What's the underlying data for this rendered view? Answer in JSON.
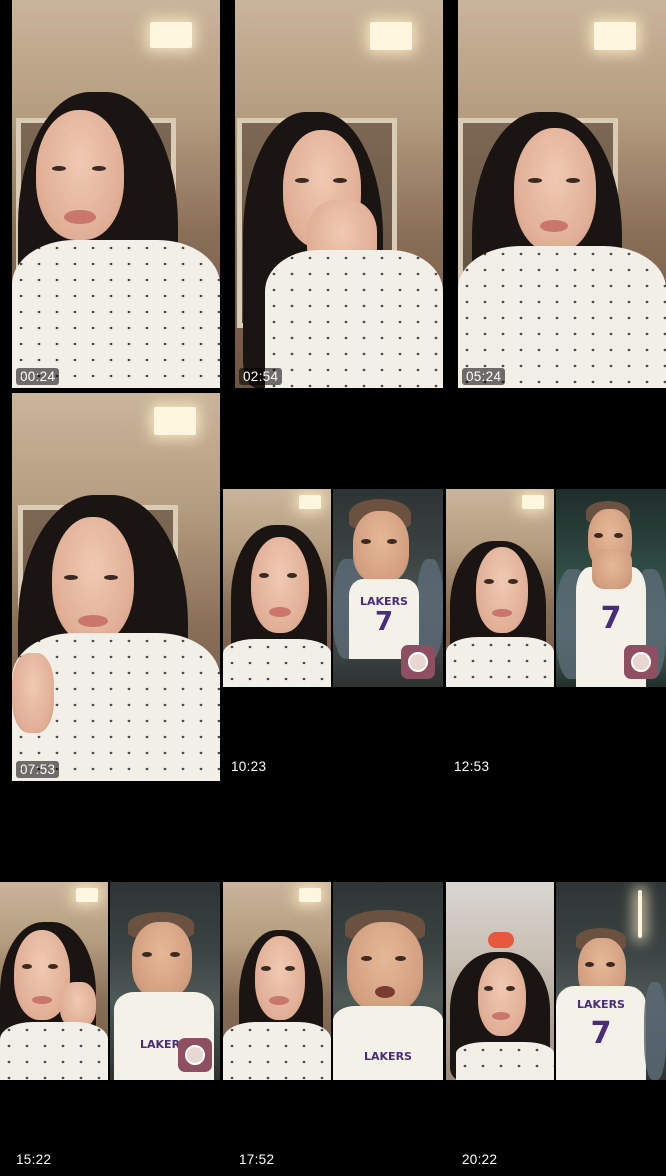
{
  "grid": {
    "tiles": [
      {
        "timestamp": "00:24",
        "layout": "single"
      },
      {
        "timestamp": "02:54",
        "layout": "single"
      },
      {
        "timestamp": "05:24",
        "layout": "single"
      },
      {
        "timestamp": "07:53",
        "layout": "single"
      },
      {
        "timestamp": "10:23",
        "layout": "split"
      },
      {
        "timestamp": "12:53",
        "layout": "split"
      },
      {
        "timestamp": "15:22",
        "layout": "split"
      },
      {
        "timestamp": "17:52",
        "layout": "split"
      },
      {
        "timestamp": "20:22",
        "layout": "split"
      }
    ]
  },
  "jersey": {
    "team": "LAKERS",
    "number": "7"
  },
  "icons": {
    "guest_avatar": "user-avatar-icon",
    "gift_badge": "gift-badge-icon"
  },
  "colors": {
    "background": "#000000",
    "timestamp_bg": "#000000",
    "avatar_bg": "#8e4f62"
  }
}
